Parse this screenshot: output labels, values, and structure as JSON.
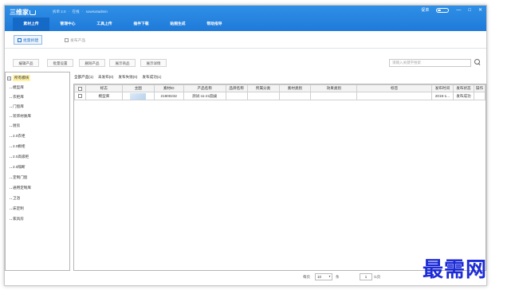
{
  "titlebar": {
    "logo_text": "三维家",
    "version": "拆单 2.0",
    "account_label": "在线",
    "username": "sowisotadmin",
    "user_label": "促单",
    "controls": [
      "—",
      "□",
      "✕"
    ]
  },
  "nav": {
    "items": [
      "素材上传",
      "管理中心",
      "工具上传",
      "插件下载",
      "贴图生成",
      "帮助指导"
    ],
    "active_index": 0
  },
  "subnav": {
    "primary_label": "批量拆建",
    "secondary_label": "发布产品"
  },
  "toolbar": {
    "buttons": [
      "编辑产品",
      "批量设置",
      "删除产品",
      "展示商品",
      "展示详情"
    ],
    "search_placeholder": "请输入关键字搜索"
  },
  "sidebar": {
    "root_label": "所有模块",
    "items": [
      "模型库",
      "衣柜库",
      "门窗库",
      "装饰材质库",
      "厨房",
      "2.0衣柜",
      "2.0橱柜",
      "2.0高级柜",
      "2.0隔断",
      "定制门窗",
      "通用定制库",
      "卫浴",
      "床定制",
      "家具房"
    ]
  },
  "tabs": [
    "全部产品(1)",
    "未发布(0)",
    "发布失败(0)",
    "发布成功(1)"
  ],
  "table": {
    "headers": [
      "",
      "标志",
      "主图",
      "素材ID",
      "产品名称",
      "品牌名称",
      "所属分类",
      "素材类别",
      "效果类别",
      "标签",
      "发布时间",
      "发布状态",
      "操作"
    ],
    "rows": [
      [
        "",
        "模型库",
        "",
        "21800232",
        "测试-11-21圆桌",
        "",
        "",
        "",
        "",
        "",
        "2019-1...",
        "发布成功",
        ""
      ]
    ]
  },
  "pager": {
    "per_page_label": "每页",
    "per_page_value": "10",
    "per_page_unit": "条",
    "page_value": "1",
    "page_total": "/1页"
  },
  "watermark": "最需网",
  "colors": {
    "titlebar": "#2a86e2",
    "nav_active": "#1569c7",
    "highlight": "#fff2a8",
    "watermark": "#1c2bd6"
  }
}
